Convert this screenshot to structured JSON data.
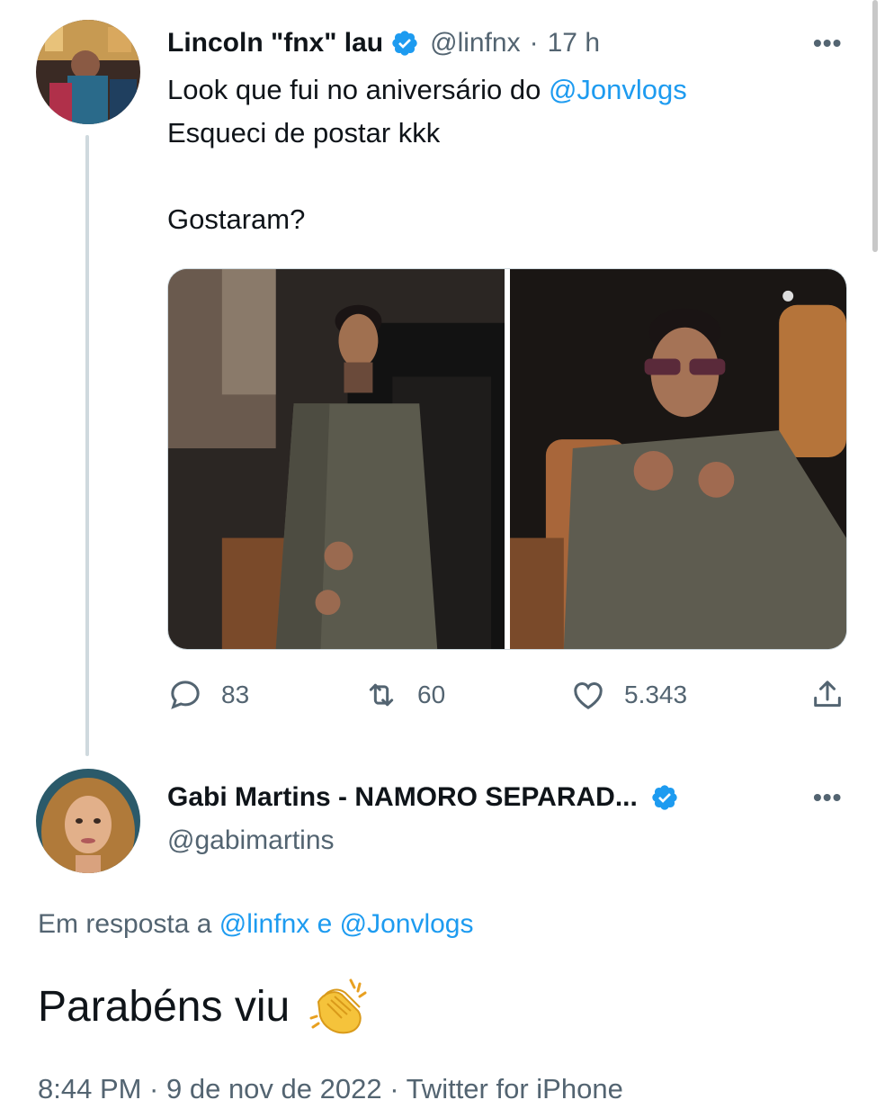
{
  "tweet1": {
    "display_name": "Lincoln \"fnx\" lau",
    "handle": "@linfnx",
    "separator": "·",
    "time": "17 h",
    "more_label": "•••",
    "text_line1": "Look que fui no aniversário do ",
    "text_mention": "@Jonvlogs",
    "text_line2": "Esqueci de postar kkk",
    "text_line3": "Gostaram?",
    "stats": {
      "replies": "83",
      "retweets": "60",
      "likes": "5.343"
    }
  },
  "tweet2": {
    "display_name": "Gabi Martins - NAMORO SEPARAD...",
    "handle": "@gabimartins",
    "more_label": "•••",
    "reply_prefix": "Em resposta a ",
    "reply_mention1": "@linfnx",
    "reply_and": " e ",
    "reply_mention2": "@Jonvlogs",
    "text": "Parabéns viu",
    "emoji": "clapping-hands-emoji",
    "footer": "8:44 PM · 9 de nov de 2022 · Twitter for iPhone"
  },
  "colors": {
    "accent": "#1d9bf0",
    "muted": "#536471",
    "text": "#0f1419",
    "thread_line": "#cfd9de"
  }
}
